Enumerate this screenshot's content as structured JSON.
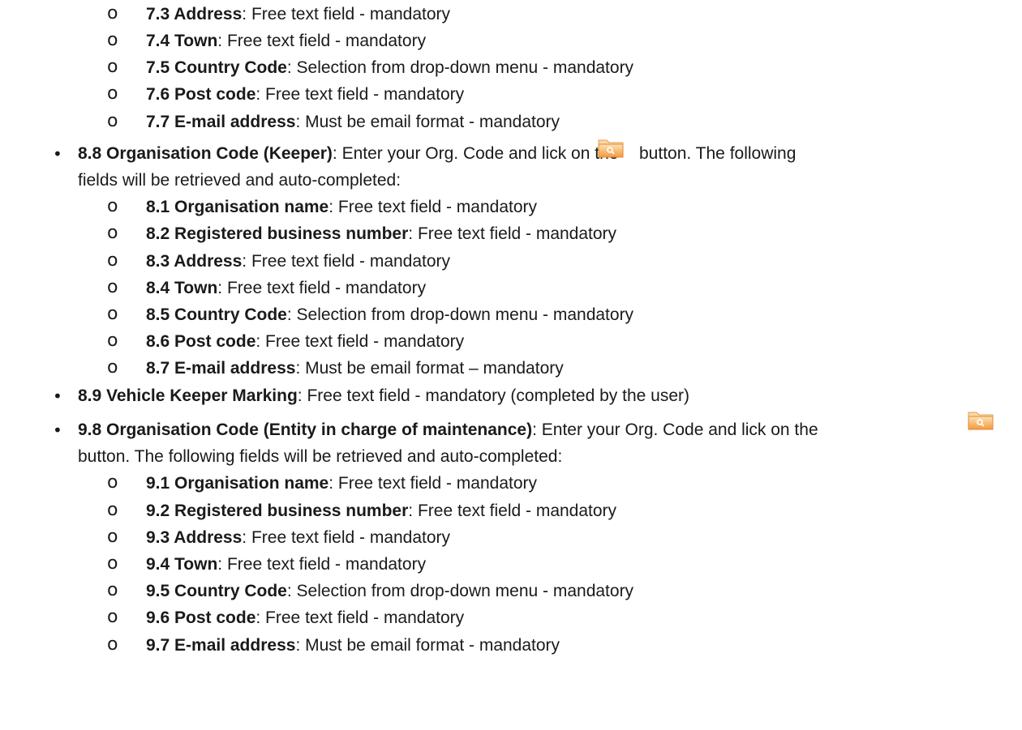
{
  "sub_marker": "o",
  "bullet_marker": "•",
  "section7": [
    {
      "label": "7.3 Address",
      "desc": ": Free text field - mandatory"
    },
    {
      "label": "7.4 Town",
      "desc": ": Free text field - mandatory"
    },
    {
      "label": "7.5 Country Code",
      "desc": ": Selection from drop-down menu - mandatory"
    },
    {
      "label": "7.6 Post code",
      "desc": ": Free text field - mandatory"
    },
    {
      "label": "7.7 E-mail address",
      "desc": ": Must be email format - mandatory"
    }
  ],
  "bullet8": {
    "label": "8.8 Organisation Code (Keeper)",
    "desc_before_icon": ": Enter your Org. Code and lick on the",
    "desc_after_icon": "button. The following",
    "continuation": "fields will be retrieved and auto-completed:",
    "icon": "folder-search-icon"
  },
  "section8": [
    {
      "label": "8.1 Organisation name",
      "desc": ": Free text field - mandatory"
    },
    {
      "label": "8.2 Registered business number",
      "desc": ": Free text field - mandatory"
    },
    {
      "label": "8.3 Address",
      "desc": ": Free text field - mandatory"
    },
    {
      "label": "8.4 Town",
      "desc": ": Free text field - mandatory"
    },
    {
      "label": "8.5 Country Code",
      "desc": ": Selection from drop-down menu - mandatory"
    },
    {
      "label": "8.6 Post code",
      "desc": ": Free text field - mandatory"
    },
    {
      "label": "8.7 E-mail address",
      "desc": ": Must be email format – mandatory"
    }
  ],
  "bullet89": {
    "label": "8.9 Vehicle Keeper Marking",
    "desc": ": Free text field - mandatory (completed by the user)"
  },
  "bullet9": {
    "label": "9.8 Organisation Code (Entity in charge of maintenance)",
    "desc": ": Enter your Org. Code and lick on the",
    "continuation": "button. The following fields will be retrieved and auto-completed:",
    "icon": "folder-search-icon"
  },
  "section9": [
    {
      "label": "9.1 Organisation name",
      "desc": ": Free text field - mandatory"
    },
    {
      "label": "9.2 Registered business number",
      "desc": ": Free text field - mandatory"
    },
    {
      "label": "9.3 Address",
      "desc": ": Free text field - mandatory"
    },
    {
      "label": "9.4 Town",
      "desc": ": Free text field - mandatory"
    },
    {
      "label": "9.5 Country Code",
      "desc": ": Selection from drop-down menu - mandatory"
    },
    {
      "label": "9.6 Post code",
      "desc": ": Free text field - mandatory"
    },
    {
      "label": "9.7 E-mail address",
      "desc": ": Must be email format - mandatory"
    }
  ],
  "colors": {
    "text": "#1a1a1a",
    "icon_orange": "#f5a54a",
    "icon_light": "#fbd7a4"
  }
}
